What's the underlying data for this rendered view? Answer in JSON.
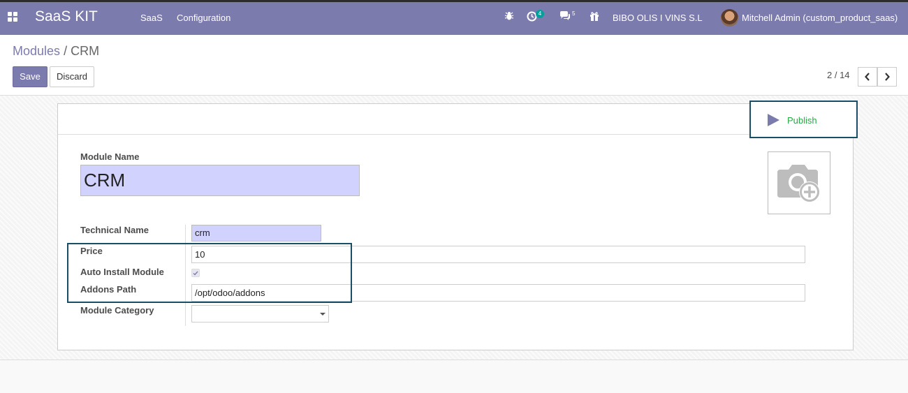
{
  "navbar": {
    "brand": "SaaS KIT",
    "menus": [
      "SaaS",
      "Configuration"
    ],
    "activity_count": "4",
    "message_count": "5",
    "company": "BIBO OLIS I VINS S.L",
    "user": "Mitchell Admin (custom_product_saas)"
  },
  "breadcrumb": {
    "parent": "Modules",
    "separator": "/",
    "current": "CRM"
  },
  "actions": {
    "save_label": "Save",
    "discard_label": "Discard"
  },
  "pager": {
    "value": "2 / 14"
  },
  "button_box": {
    "publish_label": "Publish"
  },
  "form": {
    "module_name_label": "Module Name",
    "module_name_value": "CRM",
    "technical_name_label": "Technical Name",
    "technical_name_value": "crm",
    "price_label": "Price",
    "price_value": "10",
    "auto_install_label": "Auto Install Module",
    "auto_install_checked": true,
    "addons_path_label": "Addons Path",
    "addons_path_value": "/opt/odoo/addons",
    "category_label": "Module Category",
    "category_value": ""
  },
  "colors": {
    "navbar": "#7c7bad",
    "required_field": "#d2d2ff",
    "publish": "#28a745",
    "annotation_frame": "#1a4d66"
  },
  "icons": {
    "apps": "grid-icon",
    "debug": "bug-icon",
    "activity": "clock-icon",
    "messages": "comments-icon",
    "gift": "gift-icon",
    "publish": "play-icon",
    "image": "camera-plus-icon"
  }
}
